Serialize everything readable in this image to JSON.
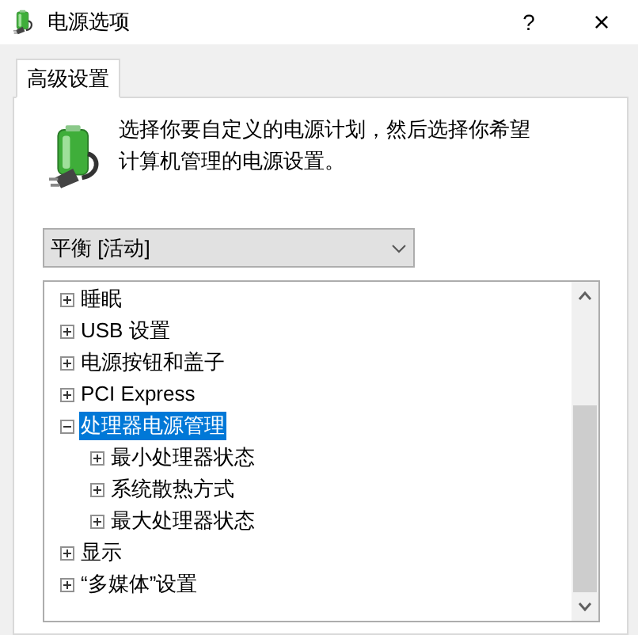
{
  "window": {
    "title": "电源选项",
    "help": "?",
    "close": "×"
  },
  "tabs": [
    {
      "label": "高级设置",
      "selected": true
    }
  ],
  "description": "选择你要自定义的电源计划，然后选择你希望计算机管理的电源设置。",
  "plan_dropdown": {
    "value": "平衡 [活动]"
  },
  "tree": [
    {
      "label": "睡眠",
      "expanded": false,
      "selected": false
    },
    {
      "label": "USB 设置",
      "expanded": false,
      "selected": false
    },
    {
      "label": "电源按钮和盖子",
      "expanded": false,
      "selected": false
    },
    {
      "label": "PCI Express",
      "expanded": false,
      "selected": false
    },
    {
      "label": "处理器电源管理",
      "expanded": true,
      "selected": true,
      "children": [
        {
          "label": "最小处理器状态",
          "expanded": false,
          "selected": false
        },
        {
          "label": "系统散热方式",
          "expanded": false,
          "selected": false
        },
        {
          "label": "最大处理器状态",
          "expanded": false,
          "selected": false
        }
      ]
    },
    {
      "label": "显示",
      "expanded": false,
      "selected": false
    },
    {
      "label": "“多媒体”设置",
      "expanded": false,
      "selected": false
    }
  ]
}
